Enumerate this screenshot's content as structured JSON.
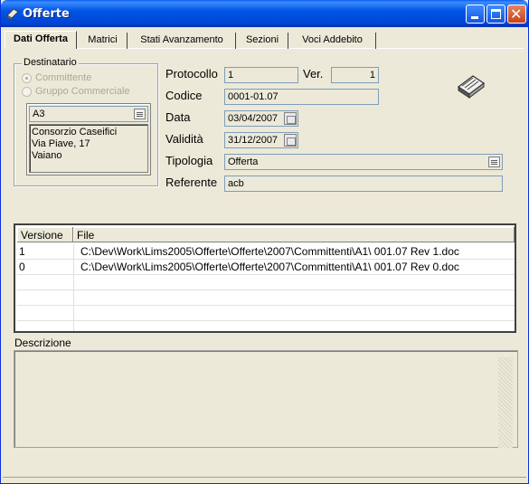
{
  "window": {
    "title": "Offerte"
  },
  "tabs": [
    {
      "label": "Dati Offerta"
    },
    {
      "label": "Matrici"
    },
    {
      "label": "Stati Avanzamento"
    },
    {
      "label": "Sezioni"
    },
    {
      "label": "Voci Addebito"
    }
  ],
  "destinatario": {
    "legend": "Destinatario",
    "options": [
      {
        "label": "Committente",
        "selected": true
      },
      {
        "label": "Gruppo Commerciale",
        "selected": false
      }
    ],
    "code": "A3",
    "address": [
      "Consorzio Caseifici",
      "Via Piave, 17",
      "Vaiano"
    ]
  },
  "form": {
    "protocollo_label": "Protocollo",
    "protocollo_value": "1",
    "ver_label": "Ver.",
    "ver_value": "1",
    "codice_label": "Codice",
    "codice_value": "0001-01.07",
    "data_label": "Data",
    "data_value": "03/04/2007",
    "validita_label": "Validità",
    "validita_value": "31/12/2007",
    "tipologia_label": "Tipologia",
    "tipologia_value": "Offerta",
    "referente_label": "Referente",
    "referente_value": "acb"
  },
  "files": {
    "columns": [
      "Versione",
      "File"
    ],
    "rows": [
      {
        "versione": "1",
        "file": "C:\\Dev\\Work\\Lims2005\\Offerte\\Offerte\\2007\\Committenti\\A1\\ 001.07 Rev 1.doc"
      },
      {
        "versione": "0",
        "file": "C:\\Dev\\Work\\Lims2005\\Offerte\\Offerte\\2007\\Committenti\\A1\\ 001.07 Rev 0.doc"
      }
    ]
  },
  "descrizione": {
    "label": "Descrizione",
    "value": ""
  },
  "icons": {
    "title": "app-book-icon",
    "document": "books-icon"
  },
  "colors": {
    "titlebar": "#0055E5",
    "face": "#ECE9D8",
    "close": "#C8411A"
  }
}
